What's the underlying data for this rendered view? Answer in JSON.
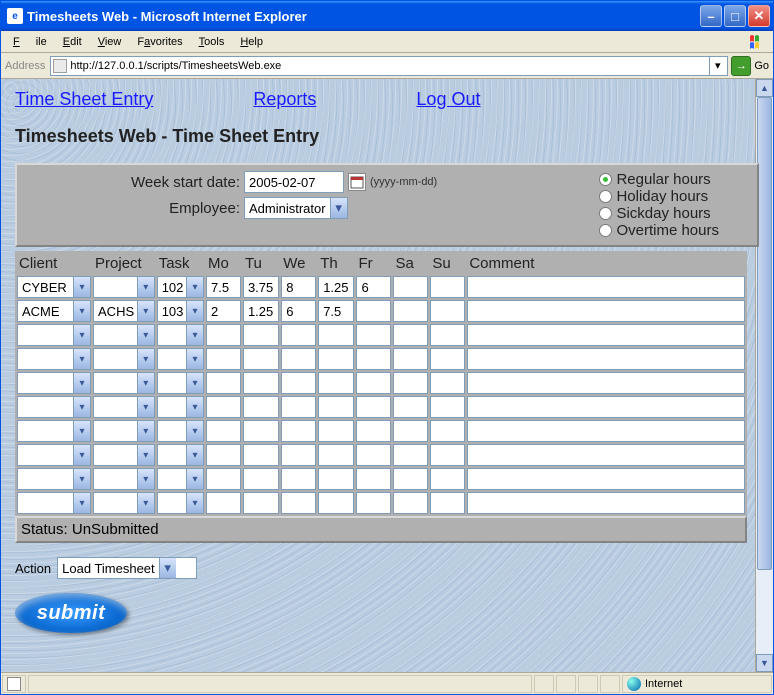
{
  "window": {
    "title": "Timesheets Web - Microsoft Internet Explorer"
  },
  "menu": {
    "file": "File",
    "edit": "Edit",
    "view": "View",
    "favorites": "Favorites",
    "tools": "Tools",
    "help": "Help"
  },
  "address": {
    "label": "Address",
    "url": "http://127.0.0.1/scripts/TimesheetsWeb.exe",
    "go": "Go"
  },
  "nav": {
    "entry": "Time Sheet Entry",
    "reports": "Reports",
    "logout": "Log Out"
  },
  "page_title": "Timesheets Web - Time Sheet Entry",
  "header": {
    "week_label": "Week start date:",
    "week_value": "2005-02-07",
    "date_hint": "(yyyy-mm-dd)",
    "employee_label": "Employee:",
    "employee_value": "Administrator",
    "radios": {
      "regular": "Regular hours",
      "holiday": "Holiday hours",
      "sickday": "Sickday hours",
      "overtime": "Overtime hours",
      "selected": "regular"
    }
  },
  "columns": {
    "client": "Client",
    "project": "Project",
    "task": "Task",
    "mo": "Mo",
    "tu": "Tu",
    "we": "We",
    "th": "Th",
    "fr": "Fr",
    "sa": "Sa",
    "su": "Su",
    "comment": "Comment"
  },
  "rows": [
    {
      "client": "CYBER",
      "project": "",
      "task": "102",
      "mo": "7.5",
      "tu": "3.75",
      "we": "8",
      "th": "1.25",
      "fr": "6",
      "sa": "",
      "su": "",
      "comment": ""
    },
    {
      "client": "ACME",
      "project": "ACHS",
      "task": "103",
      "mo": "2",
      "tu": "1.25",
      "we": "6",
      "th": "7.5",
      "fr": "",
      "sa": "",
      "su": "",
      "comment": ""
    },
    {
      "client": "",
      "project": "",
      "task": "",
      "mo": "",
      "tu": "",
      "we": "",
      "th": "",
      "fr": "",
      "sa": "",
      "su": "",
      "comment": ""
    },
    {
      "client": "",
      "project": "",
      "task": "",
      "mo": "",
      "tu": "",
      "we": "",
      "th": "",
      "fr": "",
      "sa": "",
      "su": "",
      "comment": ""
    },
    {
      "client": "",
      "project": "",
      "task": "",
      "mo": "",
      "tu": "",
      "we": "",
      "th": "",
      "fr": "",
      "sa": "",
      "su": "",
      "comment": ""
    },
    {
      "client": "",
      "project": "",
      "task": "",
      "mo": "",
      "tu": "",
      "we": "",
      "th": "",
      "fr": "",
      "sa": "",
      "su": "",
      "comment": ""
    },
    {
      "client": "",
      "project": "",
      "task": "",
      "mo": "",
      "tu": "",
      "we": "",
      "th": "",
      "fr": "",
      "sa": "",
      "su": "",
      "comment": ""
    },
    {
      "client": "",
      "project": "",
      "task": "",
      "mo": "",
      "tu": "",
      "we": "",
      "th": "",
      "fr": "",
      "sa": "",
      "su": "",
      "comment": ""
    },
    {
      "client": "",
      "project": "",
      "task": "",
      "mo": "",
      "tu": "",
      "we": "",
      "th": "",
      "fr": "",
      "sa": "",
      "su": "",
      "comment": ""
    },
    {
      "client": "",
      "project": "",
      "task": "",
      "mo": "",
      "tu": "",
      "we": "",
      "th": "",
      "fr": "",
      "sa": "",
      "su": "",
      "comment": ""
    }
  ],
  "status": "Status: UnSubmitted",
  "action": {
    "label": "Action",
    "value": "Load Timesheet"
  },
  "submit": "submit",
  "statusbar": {
    "zone": "Internet"
  }
}
